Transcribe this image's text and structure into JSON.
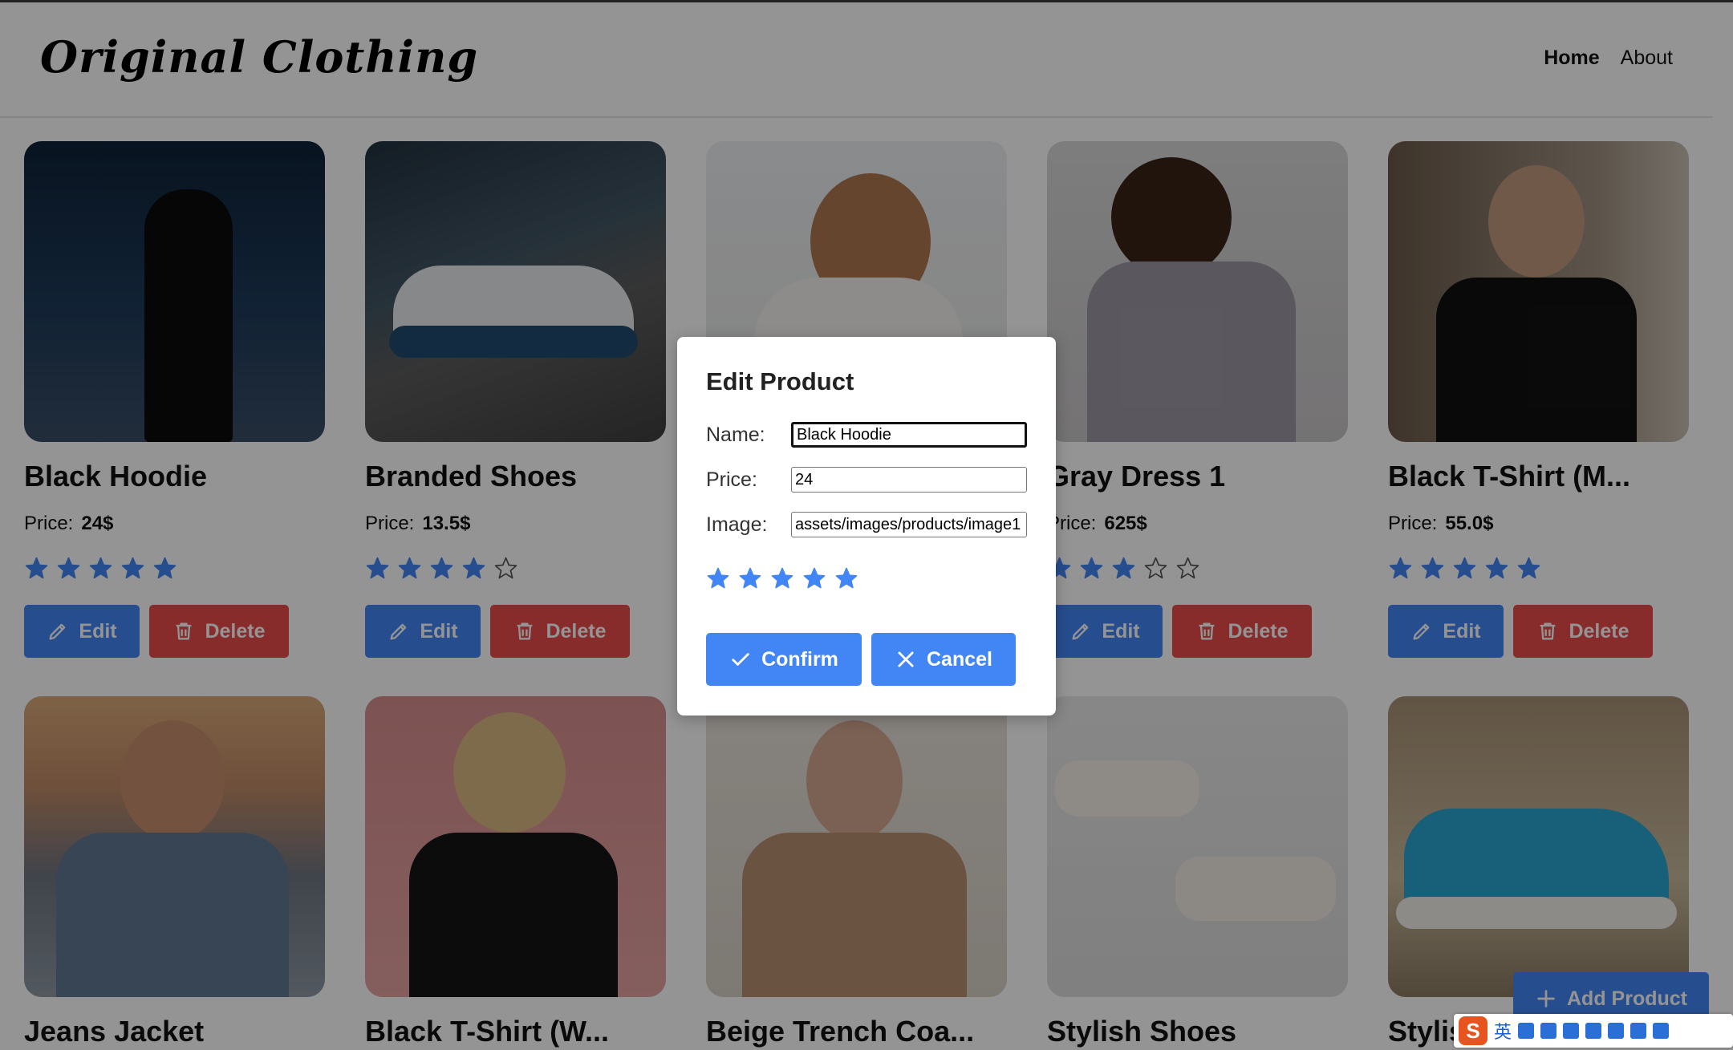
{
  "header": {
    "logo": "Original Clothing",
    "nav": [
      {
        "label": "Home",
        "active": true
      },
      {
        "label": "About",
        "active": false
      }
    ]
  },
  "products": [
    {
      "name": "Black Hoodie",
      "price_label": "Price:",
      "price": "24$",
      "rating": 5
    },
    {
      "name": "Branded Shoes",
      "price_label": "Price:",
      "price": "13.5$",
      "rating": 4
    },
    {
      "name": "",
      "price_label": "",
      "price": "",
      "rating": 0
    },
    {
      "name": "Gray Dress 1",
      "price_label": "Price:",
      "price": "625$",
      "rating": 3
    },
    {
      "name": "Black T-Shirt (M...",
      "price_label": "Price:",
      "price": "55.0$",
      "rating": 5
    },
    {
      "name": "Jeans Jacket",
      "price_label": "",
      "price": "",
      "rating": 0
    },
    {
      "name": "Black T-Shirt (W...",
      "price_label": "",
      "price": "",
      "rating": 0
    },
    {
      "name": "Beige Trench Coa...",
      "price_label": "",
      "price": "",
      "rating": 0
    },
    {
      "name": "Stylish Shoes",
      "price_label": "",
      "price": "",
      "rating": 0
    },
    {
      "name": "Stylis",
      "price_label": "",
      "price": "",
      "rating": 0
    }
  ],
  "buttons": {
    "edit": "Edit",
    "delete": "Delete",
    "add_product": "Add Product"
  },
  "modal": {
    "title": "Edit Product",
    "name_label": "Name:",
    "name_value": "Black Hoodie",
    "price_label": "Price:",
    "price_value": "24",
    "image_label": "Image:",
    "image_value": "assets/images/products/image1",
    "rating": 5,
    "confirm": "Confirm",
    "cancel": "Cancel"
  },
  "ime": {
    "lang": "英"
  },
  "colors": {
    "accent": "#4285f4",
    "danger": "#ea4a4a",
    "star": "#4285f4"
  }
}
